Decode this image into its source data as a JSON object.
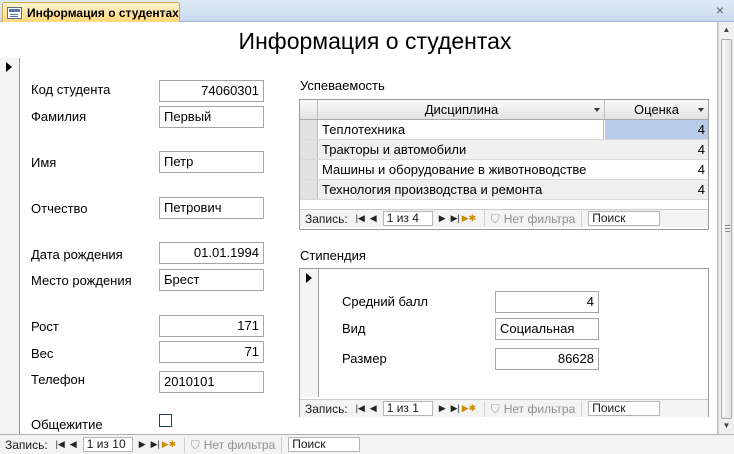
{
  "tab": {
    "title": "Информация о студентах",
    "close_glyph": "×"
  },
  "form": {
    "title": "Информация о студентах",
    "fields": {
      "student_code": {
        "label": "Код студента",
        "value": "74060301"
      },
      "last_name": {
        "label": "Фамилия",
        "value": "Первый"
      },
      "first_name": {
        "label": "Имя",
        "value": "Петр"
      },
      "patronymic": {
        "label": "Отчество",
        "value": "Петрович"
      },
      "birth_date": {
        "label": "Дата рождения",
        "value": "01.01.1994"
      },
      "birth_place": {
        "label": "Место рождения",
        "value": "Брест"
      },
      "height": {
        "label": "Рост",
        "value": "171"
      },
      "weight": {
        "label": "Вес",
        "value": "71"
      },
      "phone": {
        "label": "Телефон",
        "value": "2010101"
      },
      "dormitory": {
        "label": "Общежитие",
        "checked": false
      }
    }
  },
  "progress": {
    "caption": "Успеваемость",
    "columns": [
      "Дисциплина",
      "Оценка"
    ],
    "rows": [
      {
        "discipline": "Теплотехника",
        "grade": "4"
      },
      {
        "discipline": "Тракторы и автомобили",
        "grade": "4"
      },
      {
        "discipline": "Машины и оборудование в животноводстве",
        "grade": "4"
      },
      {
        "discipline": "Технология производства и ремонта",
        "grade": "4"
      }
    ],
    "nav": {
      "label": "Запись:",
      "position": "1 из 4",
      "filter": "Нет фильтра",
      "search": "Поиск"
    }
  },
  "stipend": {
    "caption": "Стипендия",
    "fields": {
      "avg_score": {
        "label": "Средний балл",
        "value": "4"
      },
      "type": {
        "label": "Вид",
        "value": "Социальная"
      },
      "amount": {
        "label": "Размер",
        "value": "86628"
      }
    },
    "nav": {
      "label": "Запись:",
      "position": "1 из 1",
      "filter": "Нет фильтра",
      "search": "Поиск"
    }
  },
  "main_nav": {
    "label": "Запись:",
    "position": "1 из 10",
    "filter": "Нет фильтра",
    "search": "Поиск"
  },
  "icons": {
    "first": "first-record-icon",
    "prev": "previous-record-icon",
    "next": "next-record-icon",
    "last": "last-record-icon",
    "new": "new-record-icon",
    "filter": "filter-icon"
  },
  "colors": {
    "tab_active": "#ffd77a",
    "selected_cell": "#b8cbe9",
    "checkbox_border": "#1c3f75"
  }
}
